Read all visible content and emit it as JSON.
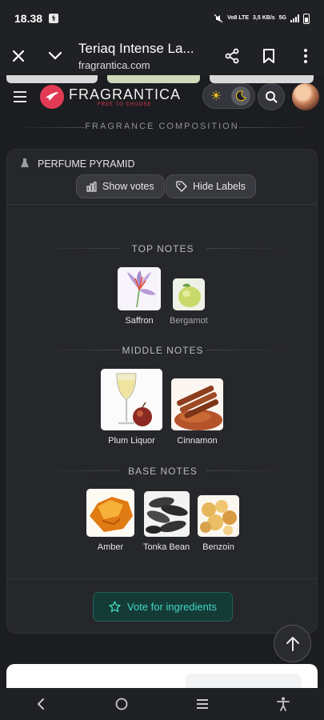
{
  "status": {
    "time": "18.38",
    "network": "Vo8 LTE",
    "speed": "3,5 KB/s",
    "gen": "5G"
  },
  "browser": {
    "page_title": "Teriaq Intense La...",
    "url": "fragrantica.com"
  },
  "site": {
    "logo_name": "FRAGRANTICA",
    "logo_tagline": "FREE TO CHOOSE"
  },
  "section": {
    "title": "FRAGRANCE COMPOSITION"
  },
  "pyramid": {
    "heading": "PERFUME PYRAMID",
    "show_votes": "Show votes",
    "hide_labels": "Hide Labels",
    "tiers": [
      {
        "title": "TOP NOTES",
        "notes": [
          {
            "name": "Saffron"
          },
          {
            "name": "Bergamot"
          }
        ]
      },
      {
        "title": "MIDDLE NOTES",
        "notes": [
          {
            "name": "Plum Liquor"
          },
          {
            "name": "Cinnamon"
          }
        ]
      },
      {
        "title": "BASE NOTES",
        "notes": [
          {
            "name": "Amber"
          },
          {
            "name": "Tonka Bean"
          },
          {
            "name": "Benzoin"
          }
        ]
      }
    ],
    "vote_button": "Vote for ingredients"
  },
  "colors": {
    "accent": "#40d9bf",
    "brand": "#e23a55",
    "background": "#1c1d20"
  },
  "icons": {
    "close": "close-icon",
    "expand": "chevron-down-icon",
    "share": "share-icon",
    "bookmark": "bookmark-icon",
    "menu": "more-vert-icon",
    "search": "search-icon",
    "sun": "sun-icon",
    "moon": "moon-icon",
    "star": "star-icon",
    "up": "arrow-up-icon"
  }
}
